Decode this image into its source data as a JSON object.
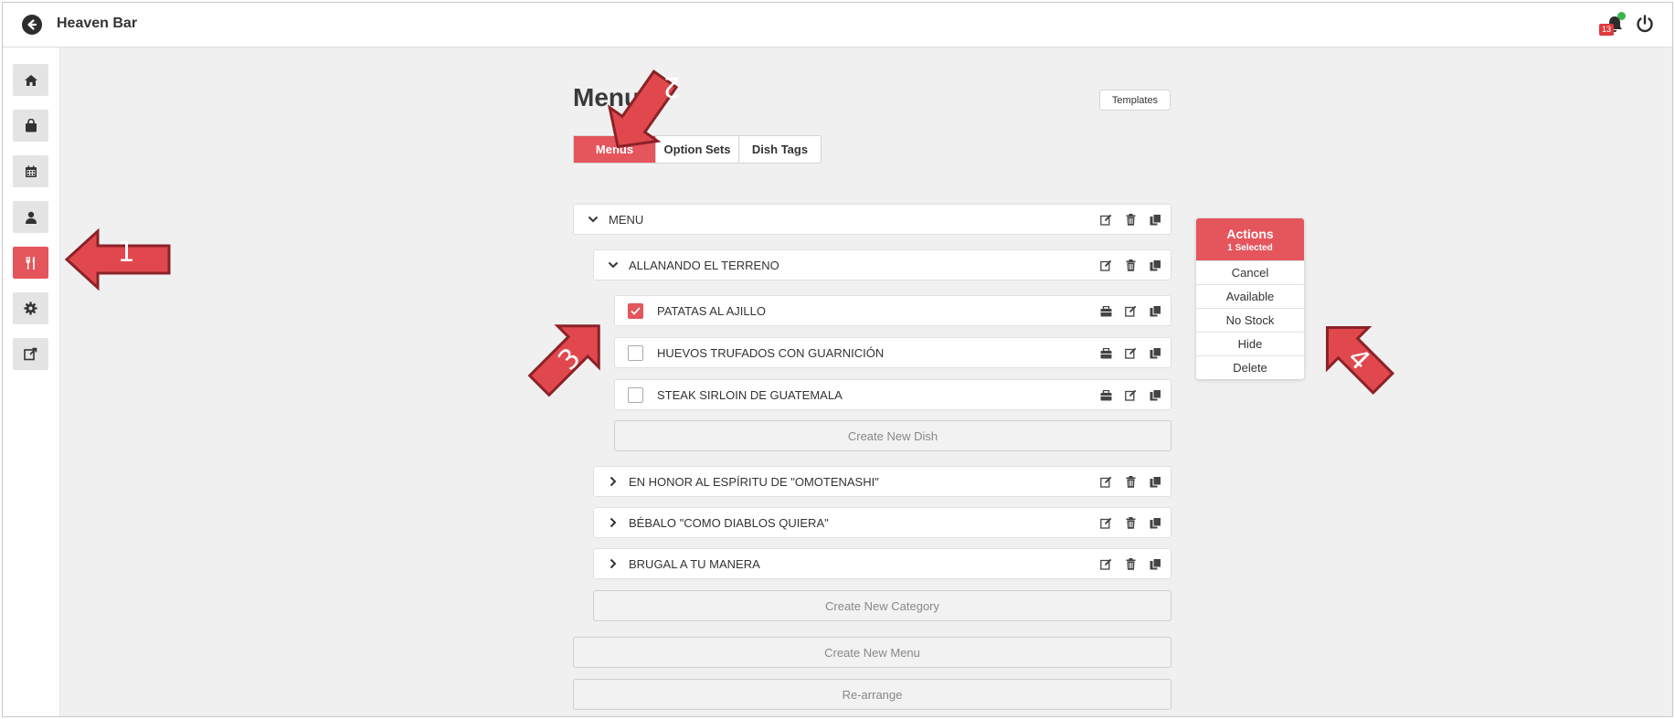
{
  "topbar": {
    "title": "Heaven Bar",
    "notification_count": "13"
  },
  "sidebar": {
    "items": [
      {
        "name": "home",
        "icon": "home-icon",
        "active": false
      },
      {
        "name": "orders",
        "icon": "bag-icon",
        "active": false
      },
      {
        "name": "calendar",
        "icon": "calendar-icon",
        "active": false
      },
      {
        "name": "users",
        "icon": "user-icon",
        "active": false
      },
      {
        "name": "menus",
        "icon": "utensils-icon",
        "active": true
      },
      {
        "name": "settings",
        "icon": "gear-icon",
        "active": false
      },
      {
        "name": "external",
        "icon": "external-link-icon",
        "active": false
      }
    ]
  },
  "main": {
    "title": "Menus",
    "templates_label": "Templates",
    "tabs": [
      {
        "label": "Menus",
        "active": true
      },
      {
        "label": "Option Sets",
        "active": false
      },
      {
        "label": "Dish Tags",
        "active": false
      }
    ],
    "menu": {
      "name": "MENU",
      "categories": [
        {
          "name": "ALLANANDO EL TERRENO",
          "expanded": true,
          "dishes": [
            {
              "name": "PATATAS AL AJILLO",
              "checked": true
            },
            {
              "name": "HUEVOS TRUFADOS CON GUARNICIÓN",
              "checked": false
            },
            {
              "name": "STEAK SIRLOIN DE GUATEMALA",
              "checked": false
            }
          ],
          "create_dish_label": "Create New Dish"
        },
        {
          "name": "EN HONOR AL ESPÍRITU DE \"OMOTENASHI\"",
          "expanded": false
        },
        {
          "name": "BÉBALO \"COMO DIABLOS QUIERA\"",
          "expanded": false
        },
        {
          "name": "BRUGAL A TU MANERA",
          "expanded": false
        }
      ],
      "create_category_label": "Create New Category"
    },
    "create_menu_label": "Create New Menu",
    "rearrange_label": "Re-arrange"
  },
  "actions_panel": {
    "title": "Actions",
    "subtitle": "1 Selected",
    "items": [
      "Cancel",
      "Available",
      "No Stock",
      "Hide",
      "Delete"
    ]
  },
  "annotations": {
    "arrow_1": "1",
    "arrow_2": "2",
    "arrow_3": "3",
    "arrow_4": "4"
  },
  "colors": {
    "accent": "#e5555c",
    "arrow_fill": "#e0484e",
    "arrow_stroke": "#8b2227",
    "badge": "#e03a3e",
    "online_dot": "#3cb34a"
  }
}
